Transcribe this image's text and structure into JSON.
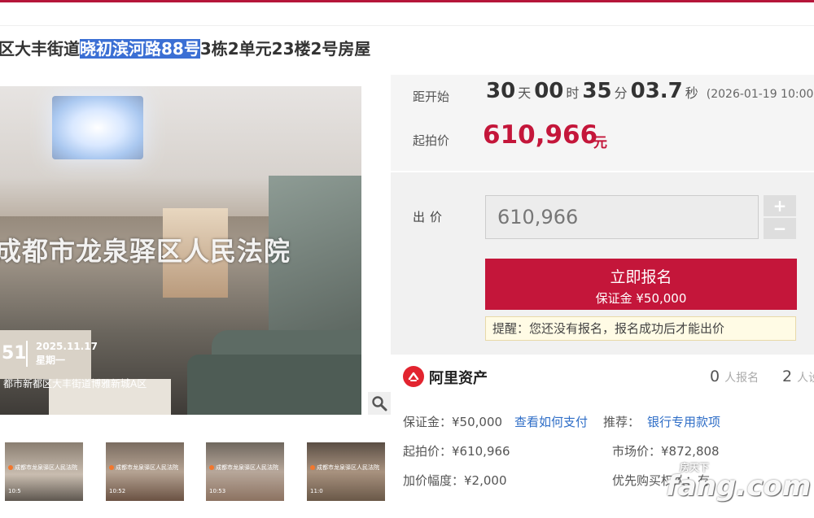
{
  "title": {
    "prefix": "区大丰街道",
    "highlight": "晓初滨河路88号",
    "suffix": "3栋2单元23楼2号房屋"
  },
  "photo": {
    "watermark": "成都市龙泉驿区人民法院",
    "time": "51",
    "date": "2025.11.17",
    "weekday": "星期一",
    "location": "都市新都区大丰街道博雅新城A区",
    "thumbnails": [
      {
        "mark": "成都市龙泉驿区人民法院",
        "time": "10:5"
      },
      {
        "mark": "成都市龙泉驿区人民法院",
        "time": "10:52"
      },
      {
        "mark": "成都市龙泉驿区人民法院",
        "time": "10:53"
      },
      {
        "mark": "成都市龙泉驿区人民法院",
        "time": "11:0"
      }
    ]
  },
  "countdown": {
    "label": "距开始",
    "days": "30",
    "days_unit": "天",
    "hours": "00",
    "hours_unit": "时",
    "minutes": "35",
    "minutes_unit": "分",
    "seconds": "03.7",
    "seconds_unit": "秒",
    "start_time": "(2026-01-19 10:00"
  },
  "start_price": {
    "label": "起拍价",
    "value": "610,966",
    "unit": "元"
  },
  "bid": {
    "label": "出价",
    "value": "610,966",
    "plus": "+",
    "minus": "−",
    "signup_label": "立即报名",
    "deposit_text": "保证金 ¥50,000",
    "notice": "提醒：您还没有报名，报名成功后才能出价"
  },
  "platform": {
    "name": "阿里资产",
    "signup_count": "0",
    "signup_unit": "人报名",
    "watch_count": "2",
    "watch_unit": "人设"
  },
  "details": {
    "deposit": "保证金：¥50,000",
    "how_to_pay": "查看如何支付",
    "recommend_label": "推荐：",
    "recommend_link": "银行专用款项",
    "start_price": "起拍价：¥610,966",
    "market_price": "市场价：¥872,808",
    "increment": "加价幅度：¥2,000",
    "priority": "优先购买权人：有"
  },
  "watermark_logo": {
    "main": "fang.com",
    "sub": "房天下"
  },
  "colors": {
    "accent": "#c4163a",
    "link": "#2f6ec7",
    "highlight": "#3b6fd4"
  }
}
